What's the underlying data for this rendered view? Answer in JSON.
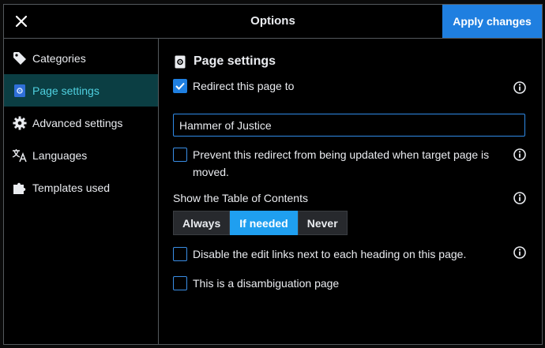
{
  "header": {
    "title": "Options",
    "apply_label": "Apply changes"
  },
  "sidebar": {
    "items": [
      {
        "label": "Categories",
        "icon": "tag-icon"
      },
      {
        "label": "Page settings",
        "icon": "page-settings-icon",
        "active": true
      },
      {
        "label": "Advanced settings",
        "icon": "gear-icon"
      },
      {
        "label": "Languages",
        "icon": "language-icon"
      },
      {
        "label": "Templates used",
        "icon": "puzzle-icon"
      }
    ]
  },
  "main": {
    "section_title": "Page settings",
    "redirect": {
      "label": "Redirect this page to",
      "checked": true
    },
    "redirect_target": {
      "value": "Hammer of Justice"
    },
    "prevent_redirect_update": {
      "label": "Prevent this redirect from being updated when target page is moved.",
      "checked": false
    },
    "toc": {
      "label": "Show the Table of Contents",
      "options": [
        "Always",
        "If needed",
        "Never"
      ],
      "selected": "If needed"
    },
    "disable_edit_links": {
      "label": "Disable the edit links next to each heading on this page.",
      "checked": false
    },
    "disambiguation": {
      "label": "This is a disambiguation page",
      "checked": false
    }
  },
  "colors": {
    "accent": "#1f7fe0",
    "active_sidebar_bg": "#0b3e43",
    "active_sidebar_text": "#4fd1e0",
    "selected_segment": "#1f9ff0"
  }
}
